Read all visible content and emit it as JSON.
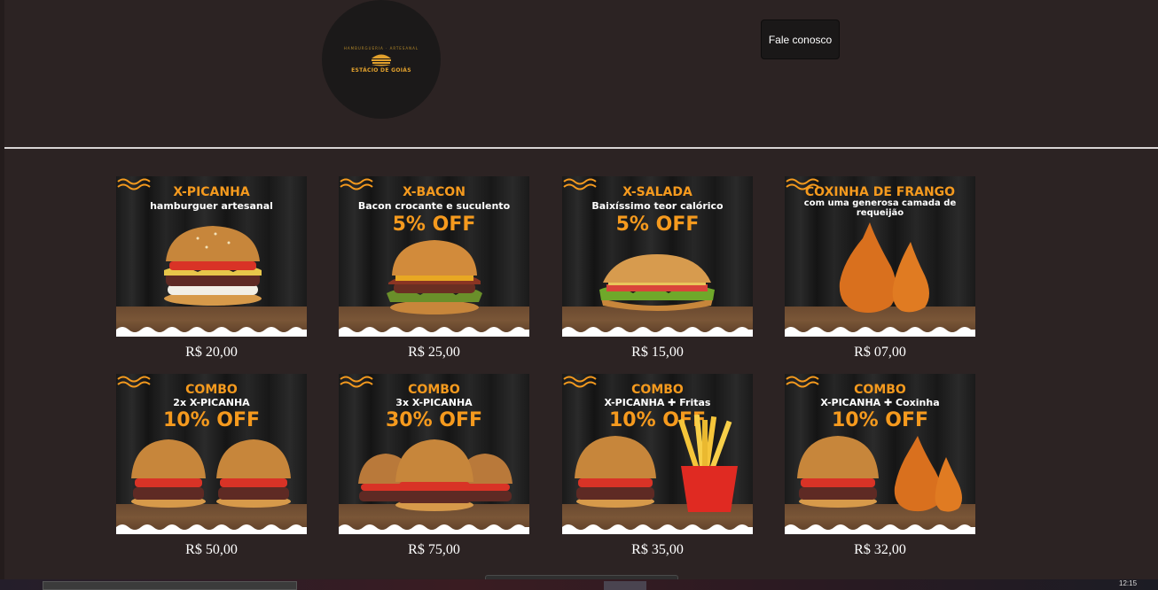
{
  "header": {
    "logo": {
      "arc_text": "HAMBURGUERIA · ARTESANAL",
      "name": "ESTÁCIO DE GOIÁS"
    },
    "contact_label": "Fale conosco"
  },
  "colors": {
    "background": "#2c2323",
    "accent_orange": "#f59a1e",
    "card_dark": "#1c1c1c",
    "button_bg": "#1a1818"
  },
  "products": [
    {
      "title": "X-PICANHA",
      "subtitle": "hamburguer artesanal",
      "offer": "",
      "price": "R$ 20,00",
      "image": "burger-icon"
    },
    {
      "title": "X-BACON",
      "subtitle": "Bacon crocante e suculento",
      "offer": "5% OFF",
      "price": "R$ 25,00",
      "image": "bacon-burger-icon"
    },
    {
      "title": "X-SALADA",
      "subtitle": "Baixíssimo teor calórico",
      "offer": "5% OFF",
      "price": "R$ 15,00",
      "image": "sandwich-icon"
    },
    {
      "title": "COXINHA DE FRANGO",
      "subtitle": "com uma generosa camada de requeijão",
      "offer": "",
      "price": "R$ 07,00",
      "image": "coxinha-icon"
    },
    {
      "title": "COMBO",
      "subtitle": "2x X-PICANHA",
      "offer": "10% OFF",
      "price": "R$ 50,00",
      "image": "two-burgers-icon"
    },
    {
      "title": "COMBO",
      "subtitle": "3x X-PICANHA",
      "offer": "30% OFF",
      "price": "R$ 75,00",
      "image": "three-burgers-icon"
    },
    {
      "title": "COMBO",
      "subtitle": "X-PICANHA ✚ Fritas",
      "offer": "10% OFF",
      "price": "R$ 35,00",
      "image": "burger-fries-icon"
    },
    {
      "title": "COMBO",
      "subtitle": "X-PICANHA ✚ Coxinha",
      "offer": "10% OFF",
      "price": "R$ 32,00",
      "image": "burger-coxinha-icon"
    }
  ],
  "taskbar": {
    "clock": "12:15"
  }
}
